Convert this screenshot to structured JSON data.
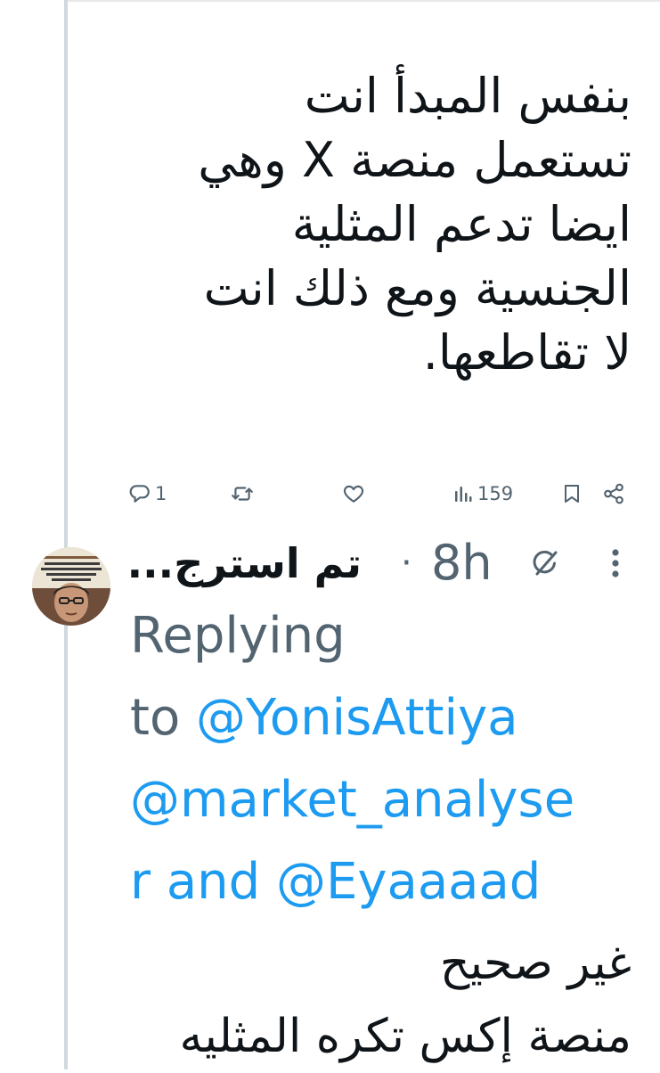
{
  "tweet": {
    "lines": [
      "بنفس المبدأ انت",
      "تستعمل منصة X وهي",
      "ايضا تدعم المثلية",
      "الجنسية ومع ذلك انت",
      "لا تقاطعها."
    ],
    "actions": {
      "reply_count": "1",
      "views_count": "159"
    }
  },
  "reply": {
    "author_name": "تم استرج...",
    "separator": "·",
    "time": "8h",
    "replying_prefix": "Replying",
    "replying_to": "to",
    "mention_1": "@YonisAttiya",
    "mention_2a": "@market_analyse",
    "mention_2b": "r",
    "and_text": "and",
    "mention_3": "@Eyaaaad",
    "lines": [
      "غير صحيح",
      "منصة إكس تكره المثليه"
    ]
  },
  "colors": {
    "text": "#0f1419",
    "secondary": "#536471",
    "link": "#1d9bf0",
    "thread_line": "#cfd9de"
  },
  "icons": {
    "reply": "reply-icon",
    "repost": "repost-icon",
    "like": "heart-icon",
    "views": "views-icon",
    "bookmark": "bookmark-icon",
    "share": "share-icon",
    "grok": "grok-icon",
    "more": "more-icon"
  }
}
